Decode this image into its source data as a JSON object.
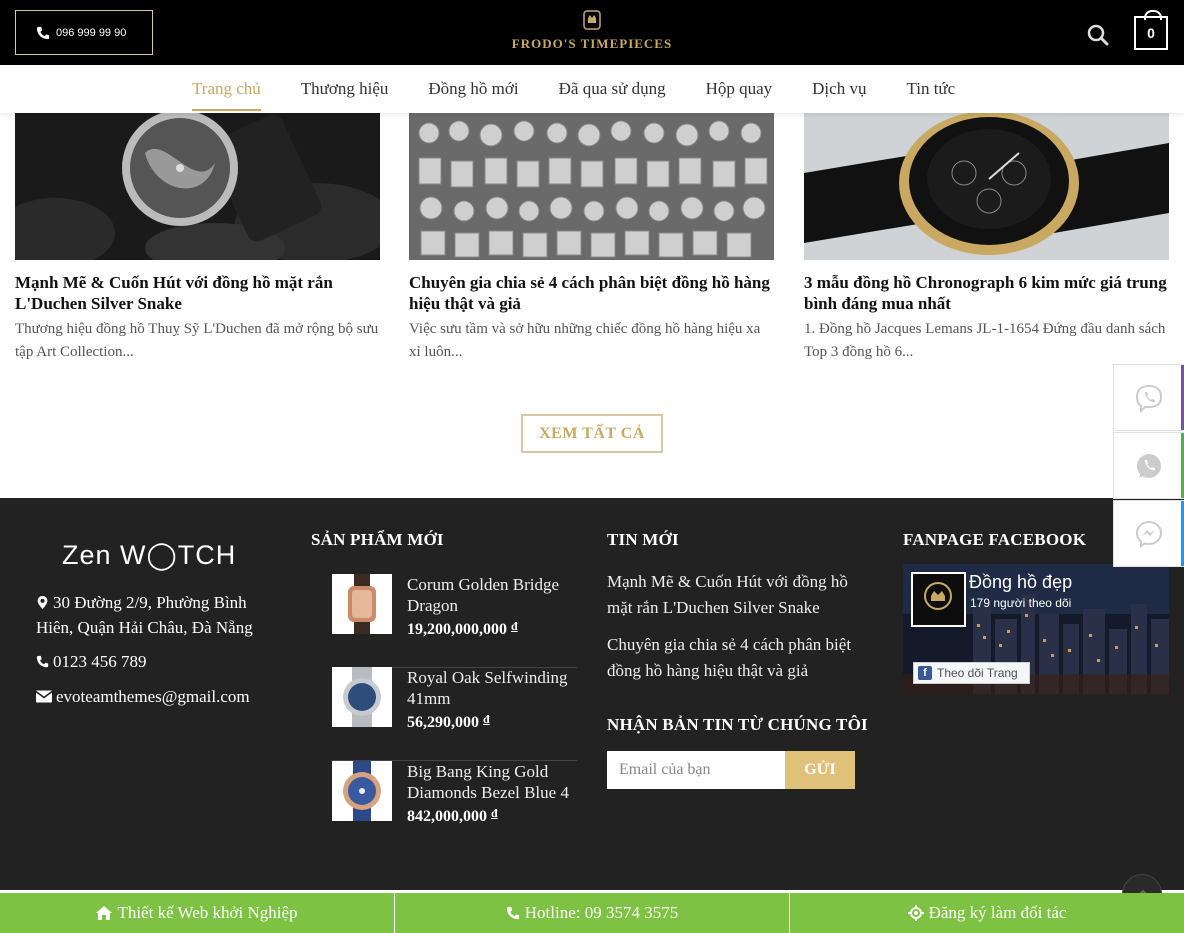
{
  "header": {
    "phone": "096 999 99 90",
    "brand": "FRODO'S TIMEPIECES",
    "cart_count": "0"
  },
  "nav": {
    "items": [
      {
        "label": "Trang chủ",
        "active": true
      },
      {
        "label": "Thương hiệu"
      },
      {
        "label": "Đồng hồ mới"
      },
      {
        "label": "Đã qua sử dụng"
      },
      {
        "label": "Hộp quay"
      },
      {
        "label": "Dịch vụ"
      },
      {
        "label": "Tin tức"
      }
    ]
  },
  "posts": [
    {
      "title": "Mạnh Mẽ & Cuốn Hút với đồng hồ mặt rắn L'Duchen Silver Snake",
      "excerpt": "Thương hiệu đồng hồ Thuỵ Sỹ L'Duchen đã mở rộng bộ sưu tập Art Collection..."
    },
    {
      "title": "Chuyên gia chia sẻ 4 cách phân biệt đồng hồ hàng hiệu thật và giả",
      "excerpt": "Việc sưu tầm và sở hữu những chiếc đồng hồ hàng hiệu xa xỉ luôn..."
    },
    {
      "title": "3 mẫu đồng hồ Chronograph 6 kim mức giá trung bình đáng mua nhất",
      "excerpt": "1. Đồng hồ Jacques Lemans JL-1-1654 Đứng đầu danh sách Top 3 đồng hồ 6..."
    }
  ],
  "view_all": "XEM TẤT CẢ",
  "footer": {
    "logo": "Zen W◯TCH",
    "address": "30 Đường 2/9, Phường Bình Hiên, Quận Hải Châu, Đà Nẵng",
    "phone": "0123 456 789",
    "email": "evoteamthemes@gmail.com",
    "products_heading": "SẢN PHẨM MỚI",
    "products": [
      {
        "name": "Corum Golden Bridge Dragon",
        "price": "19,200,000,000",
        "currency": "đ"
      },
      {
        "name": "Royal Oak Selfwinding 41mm",
        "price": "56,290,000",
        "currency": "đ"
      },
      {
        "name": "Big Bang King Gold Diamonds Bezel Blue 4",
        "price": "842,000,000",
        "currency": "đ"
      }
    ],
    "news_heading": "TIN MỚI",
    "news": [
      "Mạnh Mẽ & Cuốn Hút với đồng hồ mặt rắn L'Duchen Silver Snake",
      "Chuyên gia chia sẻ 4 cách phân biệt đồng hồ hàng hiệu thật và giả"
    ],
    "newsletter_heading": "NHẬN BẢN TIN TỪ CHÚNG TÔI",
    "newsletter_placeholder": "Email của bạn",
    "newsletter_button": "GỬI",
    "fanpage_heading": "FANPAGE FACEBOOK",
    "fanpage": {
      "name": "Đồng hồ đẹp",
      "followers": "179 người theo dõi",
      "follow_button": "Theo dõi Trang"
    }
  },
  "bottombar": {
    "left": "Thiết kế Web khởi Nghiệp",
    "center": "Hotline: 09 3574 3575",
    "right": "Đăng ký làm đối tác"
  },
  "colors": {
    "accent_gold": "#c9a961",
    "footer_bg": "#222222",
    "bottombar_green": "#7dc242"
  }
}
